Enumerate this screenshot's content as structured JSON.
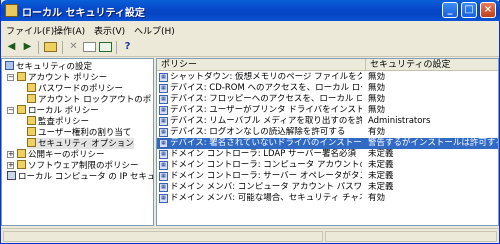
{
  "window": {
    "title": "ローカル セキュリティ設定"
  },
  "menus": [
    "ファイル(F)",
    "操作(A)",
    "表示(V)",
    "ヘルプ(H)"
  ],
  "tree": [
    {
      "label": "セキュリティの設定",
      "icon": "cfg"
    },
    {
      "label": "アカウント ポリシー",
      "icon": "folder"
    },
    {
      "label": "パスワードのポリシー",
      "icon": "folder"
    },
    {
      "label": "アカウント ロックアウトのポリシー",
      "icon": "folder"
    },
    {
      "label": "ローカル ポリシー",
      "icon": "folder"
    },
    {
      "label": "監査ポリシー",
      "icon": "folder"
    },
    {
      "label": "ユーザー権利の割り当て",
      "icon": "folder"
    },
    {
      "label": "セキュリティ オプション",
      "icon": "folder"
    },
    {
      "label": "公開キーのポリシー",
      "icon": "folder"
    },
    {
      "label": "ソフトウェア制限のポリシー",
      "icon": "folder"
    },
    {
      "label": "ローカル コンピュータ の IP セキュリティ",
      "icon": "pc"
    }
  ],
  "columns": {
    "policy": "ポリシー",
    "setting": "セキュリティの設定"
  },
  "rows": [
    {
      "policy": "シャットダウン: 仮想メモリのページ ファイルをクリアする",
      "setting": "無効"
    },
    {
      "policy": "デバイス: CD-ROM へのアクセスを、ローカル ログオン ユ...",
      "setting": "無効"
    },
    {
      "policy": "デバイス: フロッピーへのアクセスを、ローカル ログオン ユ...",
      "setting": "無効"
    },
    {
      "policy": "デバイス: ユーザーがプリンタ ドライバをインストールできない...",
      "setting": "無効"
    },
    {
      "policy": "デバイス: リムーバブル メディアを取り出すのを許可する",
      "setting": "Administrators"
    },
    {
      "policy": "デバイス: ログオンなしの読込解除を許可する",
      "setting": "有効"
    },
    {
      "policy": "デバイス: 署名されていないドライバのインストール時の動作",
      "setting": "警告するがインストールは許可する",
      "selected": true
    },
    {
      "policy": "ドメイン コントローラ: LDAP サーバー署名必須",
      "setting": "未定義"
    },
    {
      "policy": "ドメイン コントローラ: コンピュータ アカウントのパスワードの...",
      "setting": "未定義"
    },
    {
      "policy": "ドメイン コントローラ: サーバー オペレータがタスクのスケジュ...",
      "setting": "未定義"
    },
    {
      "policy": "ドメイン メンバ: コンピュータ アカウント パスワード: 定期的...",
      "setting": "未定義"
    },
    {
      "policy": "ドメイン メンバ: 可能な場合、セキュリティ チャネルのデータ...",
      "setting": "有効"
    }
  ],
  "colors": {
    "selection": "#316ac5",
    "titlebar": "#0647c9"
  }
}
